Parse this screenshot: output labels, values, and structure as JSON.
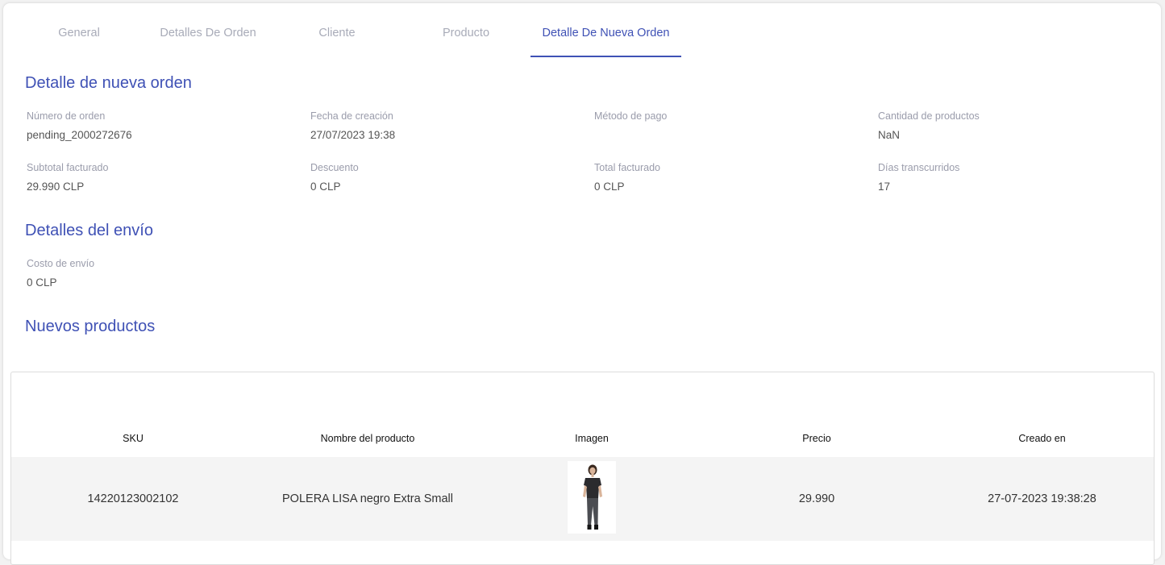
{
  "tabs": [
    {
      "label": "General"
    },
    {
      "label": "Detalles De Orden"
    },
    {
      "label": "Cliente"
    },
    {
      "label": "Producto"
    },
    {
      "label": "Detalle De Nueva Orden"
    }
  ],
  "order_section": {
    "title": "Detalle de nueva orden",
    "fields": [
      {
        "label": "Número de orden",
        "value": "pending_2000272676"
      },
      {
        "label": "Fecha de creación",
        "value": "27/07/2023 19:38"
      },
      {
        "label": "Método de pago",
        "value": ""
      },
      {
        "label": "Cantidad de productos",
        "value": "NaN"
      },
      {
        "label": "Subtotal facturado",
        "value": "29.990 CLP"
      },
      {
        "label": "Descuento",
        "value": "0 CLP"
      },
      {
        "label": "Total facturado",
        "value": "0 CLP"
      },
      {
        "label": "Días transcurridos",
        "value": "17"
      }
    ]
  },
  "shipping_section": {
    "title": "Detalles del envío",
    "fields": [
      {
        "label": "Costo de envío",
        "value": "0 CLP"
      }
    ]
  },
  "products_section": {
    "title": "Nuevos productos",
    "columns": [
      "SKU",
      "Nombre del producto",
      "Imagen",
      "Precio",
      "Creado en"
    ],
    "rows": [
      {
        "sku": "14220123002102",
        "name": "POLERA LISA negro Extra Small",
        "image": "product-photo",
        "price": "29.990",
        "created": "27-07-2023 19:38:28"
      }
    ]
  },
  "colors": {
    "accent": "#3f51b5",
    "tab_inactive": "#a8abb8",
    "label": "#9a9cab",
    "row_bg": "#f4f4f4"
  }
}
